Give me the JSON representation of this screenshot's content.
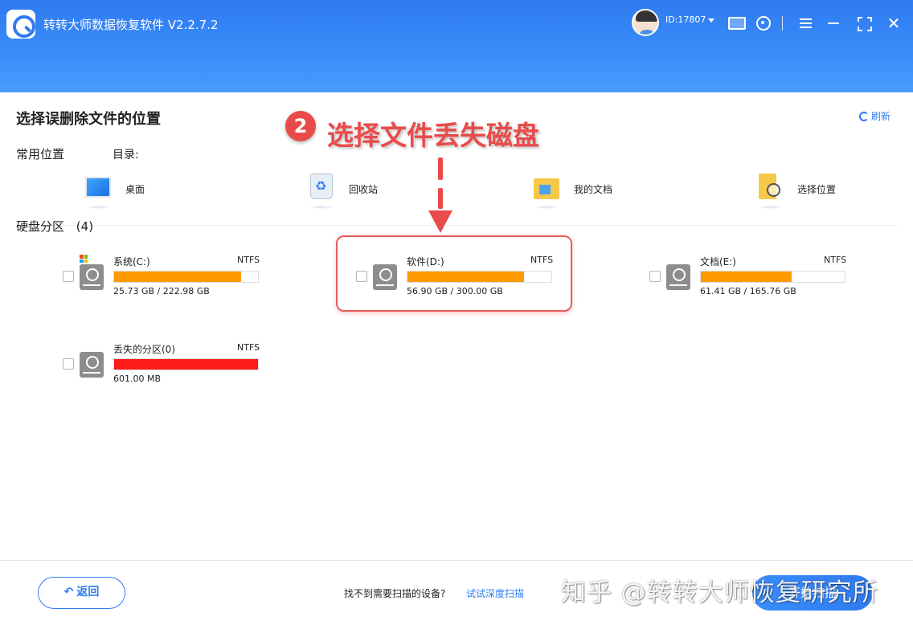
{
  "header": {
    "title": "转转大师数据恢复软件 V2.2.7.2",
    "user_id": "ID:17807"
  },
  "content": {
    "page_title": "选择误删除文件的位置",
    "refresh_label": "刷新",
    "common_locations_label": "常用位置",
    "directory_label": "目录:",
    "locations": [
      {
        "label": "桌面",
        "icon": "desktop-icon"
      },
      {
        "label": "回收站",
        "icon": "recycle-bin-icon"
      },
      {
        "label": "我的文档",
        "icon": "documents-folder-icon"
      },
      {
        "label": "选择位置",
        "icon": "choose-location-icon"
      }
    ],
    "disk_section_label": "硬盘分区",
    "disk_count": "(4)",
    "drives": [
      {
        "name": "系统(C:)",
        "fs": "NTFS",
        "size": "25.73 GB / 222.98 GB",
        "fill": 0.885,
        "color": "#ff9a00",
        "system": true
      },
      {
        "name": "软件(D:)",
        "fs": "NTFS",
        "size": "56.90 GB / 300.00 GB",
        "fill": 0.81,
        "color": "#ff9a00",
        "system": false
      },
      {
        "name": "文档(E:)",
        "fs": "NTFS",
        "size": "61.41 GB / 165.76 GB",
        "fill": 0.63,
        "color": "#ff9a00",
        "system": false
      },
      {
        "name": "丢失的分区(0)",
        "fs": "NTFS",
        "size": "601.00 MB",
        "fill": 1.0,
        "color": "#ff1a1a",
        "system": false
      }
    ]
  },
  "annotation": {
    "step_number": "2",
    "step_text": "选择文件丢失磁盘"
  },
  "footer": {
    "back_label": "返回",
    "not_found_text": "找不到需要扫描的设备?",
    "deep_scan_link": "试试深度扫描",
    "scan_label": "开始扫描",
    "watermark": "知乎 @转转大师恢复研究所"
  },
  "colors": {
    "accent": "#2f7bf0",
    "usage_bar": "#ff9a00",
    "lost_partition_bar": "#ff1a1a",
    "annotation": "#e94b4b"
  }
}
